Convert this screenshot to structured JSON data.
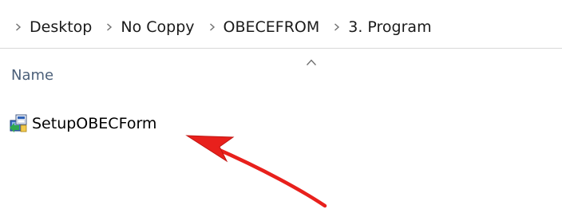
{
  "breadcrumb": {
    "items": [
      {
        "label": "Desktop"
      },
      {
        "label": "No Coppy"
      },
      {
        "label": "OBECEFROM"
      },
      {
        "label": "3. Program"
      }
    ]
  },
  "columns": {
    "name_label": "Name",
    "sort_direction": "ascending"
  },
  "files": [
    {
      "name": "SetupOBECForm",
      "icon": "installer-icon"
    }
  ],
  "annotation": {
    "arrow_color": "#e8201c",
    "points_to": "SetupOBECForm"
  }
}
